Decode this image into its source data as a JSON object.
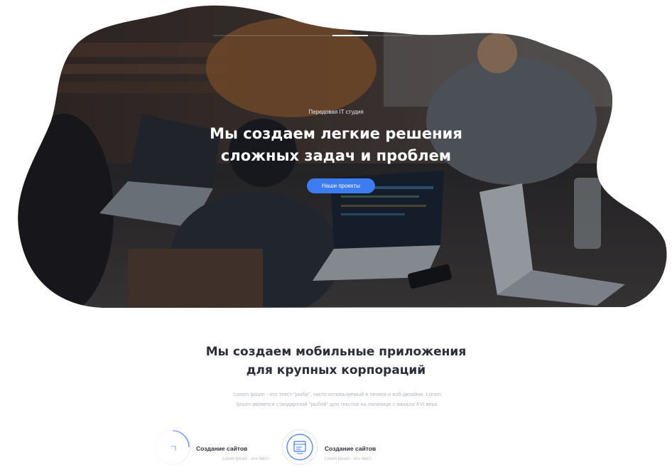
{
  "hero": {
    "tagline": "Передовая IT студия",
    "title_line1": "Мы создаем легкие решения",
    "title_line2": "сложных задач и проблем",
    "cta_label": "Наши проекты"
  },
  "section": {
    "title_line1": "Мы создаем мобильные приложения",
    "title_line2": "для крупных корпораций",
    "desc_line1": "Lorem Ipsum - это текст-\"рыба\", часто используемый в печати и вэб-дизайне. Lorem",
    "desc_line2": "Ipsum является стандартной \"рыбой\" для текстов на латинице с начала XVI века."
  },
  "services": [
    {
      "title": "Создание сайтов",
      "text": "Lorem Ipsum - это текст-",
      "icon": "browser-icon"
    },
    {
      "title": "Создание сайтов",
      "text": "Lorem Ipsum - это текст-",
      "icon": "website-builder-icon"
    }
  ],
  "colors": {
    "accent": "#3d7bf0",
    "heading": "#2b2f3a",
    "muted": "#b3b7c2"
  }
}
